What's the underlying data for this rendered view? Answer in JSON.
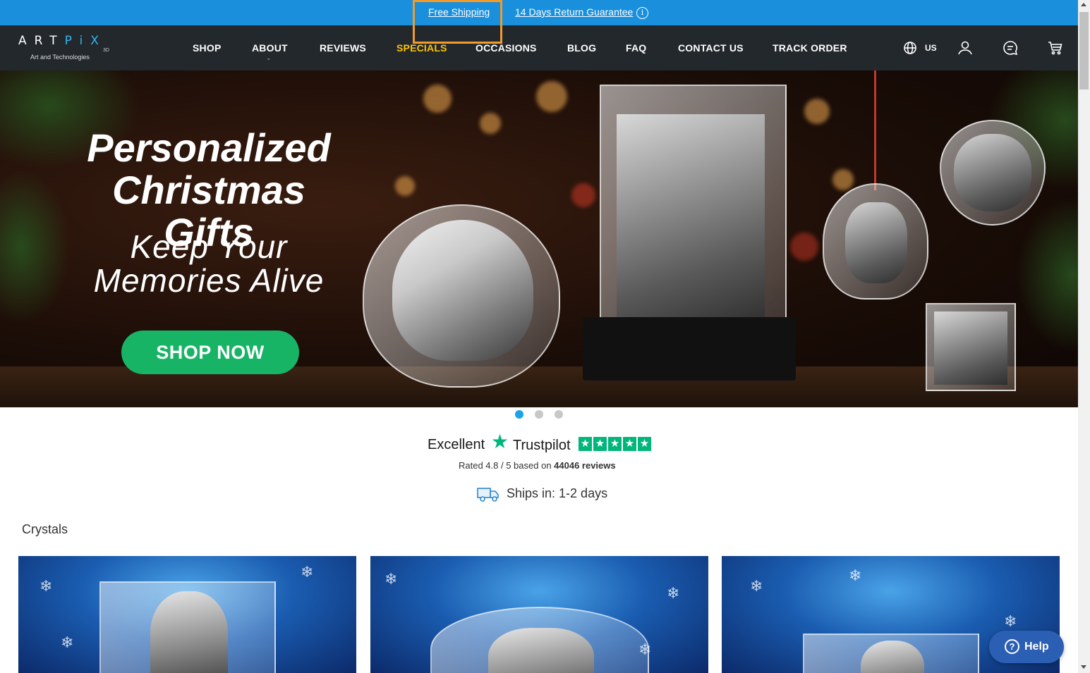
{
  "topbar": {
    "free_shipping": "Free Shipping",
    "return_guarantee": "14 Days Return Guarantee",
    "info_icon": "info-icon"
  },
  "logo": {
    "word_a": "ART",
    "word_b": "PiX",
    "suffix": "3D",
    "tagline": "Art and Technologies"
  },
  "nav": {
    "items": [
      {
        "label": "SHOP"
      },
      {
        "label": "ABOUT"
      },
      {
        "label": "REVIEWS"
      },
      {
        "label": "SPECIALS"
      },
      {
        "label": "OCCASIONS"
      },
      {
        "label": "BLOG"
      },
      {
        "label": "FAQ"
      },
      {
        "label": "CONTACT US"
      },
      {
        "label": "TRACK ORDER"
      }
    ],
    "region": "US",
    "icons": [
      "globe-icon",
      "user-icon",
      "chat-icon",
      "cart-icon"
    ]
  },
  "hero": {
    "title_line1": "Personalized",
    "title_line2": "Christmas Gifts",
    "sub_line1": "Keep Your",
    "sub_line2": "Memories Alive",
    "cta": "SHOP NOW",
    "slide_count": 3,
    "active_slide": 1
  },
  "trustpilot": {
    "excellent": "Excellent",
    "brand": "Trustpilot",
    "rating_prefix": "Rated 4.8 / 5 based on ",
    "reviews": "44046 reviews",
    "stars": 5
  },
  "shipping": {
    "text": "Ships in: 1-2 days"
  },
  "section": {
    "title": "Crystals"
  },
  "help": {
    "label": "Help"
  },
  "colors": {
    "topbar": "#1a8fdc",
    "nav": "#23282d",
    "specials": "#ffc400",
    "cta": "#17b466",
    "trustpilot": "#00b67a",
    "help": "#2b5fb4"
  }
}
